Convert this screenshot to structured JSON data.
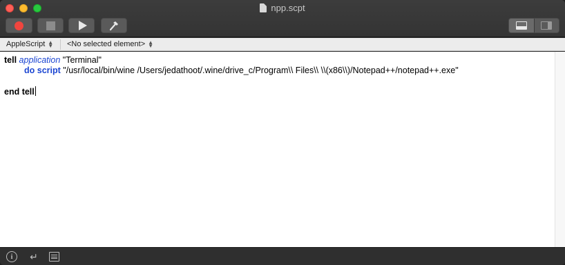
{
  "window": {
    "title": "npp.scpt"
  },
  "toolbar": {
    "buttons": [
      {
        "name": "record",
        "icon": "record-icon"
      },
      {
        "name": "stop",
        "icon": "stop-icon"
      },
      {
        "name": "run",
        "icon": "play-icon"
      },
      {
        "name": "compile",
        "icon": "hammer-icon"
      }
    ],
    "view_segments": [
      {
        "name": "show-log",
        "icon": "bottom-pane-icon"
      },
      {
        "name": "show-sidebar",
        "icon": "side-pane-icon"
      }
    ]
  },
  "navbar": {
    "language": "AppleScript",
    "element": "<No selected element>"
  },
  "editor": {
    "line1": {
      "kw": "tell",
      "cls": "application",
      "str": "\"Terminal\""
    },
    "line2": {
      "cmd": "do script",
      "str": "\"/usr/local/bin/wine /Users/jedathoot/.wine/drive_c/Program\\\\ Files\\\\ \\\\(x86\\\\)/Notepad++/notepad++.exe\""
    },
    "line4": {
      "kw": "end tell"
    }
  },
  "bottombar": {
    "icons": [
      "info-icon",
      "return-icon",
      "list-icon"
    ]
  },
  "colors": {
    "keyword": "#000000",
    "class": "#1c46d2",
    "command": "#1c46d2",
    "record": "#f0453e"
  }
}
